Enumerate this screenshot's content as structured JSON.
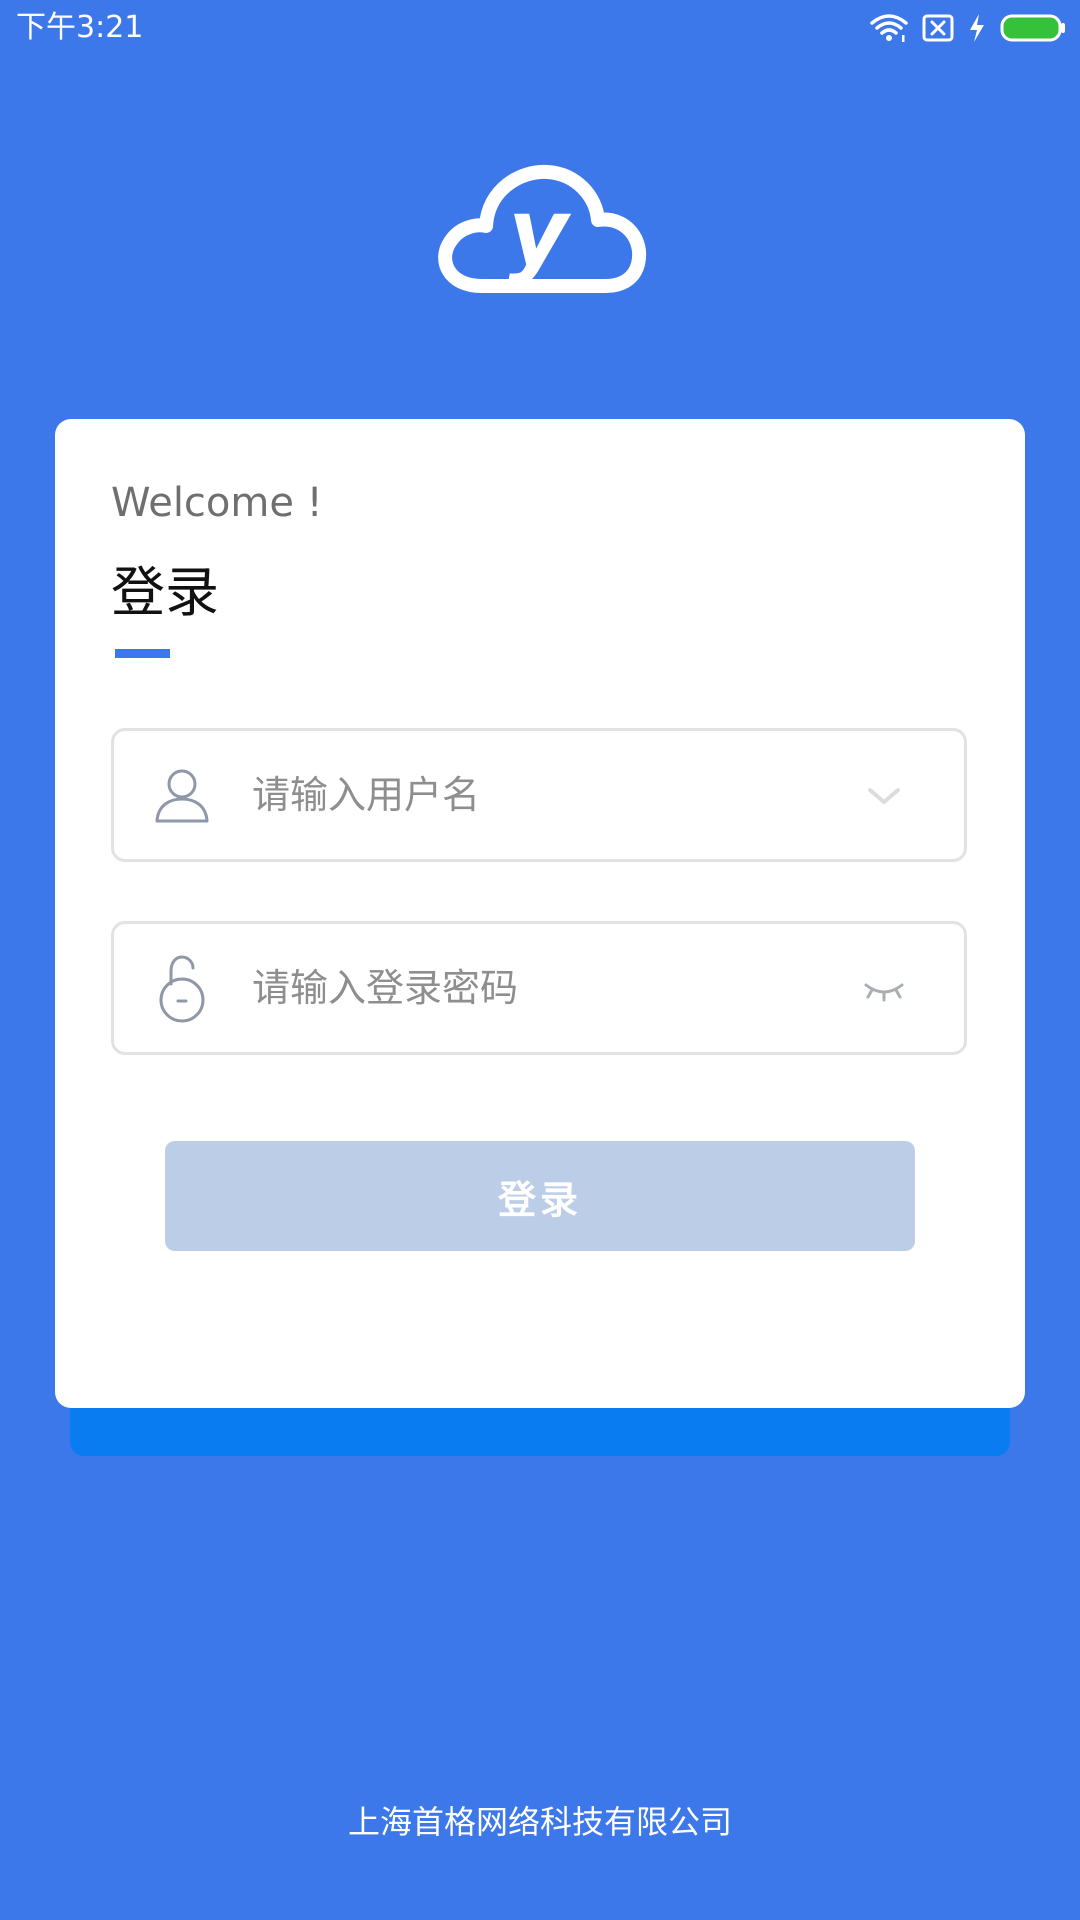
{
  "status_bar": {
    "time": "下午3:21",
    "icons": [
      "wifi-icon",
      "sim-off-icon",
      "charging-icon",
      "battery-icon"
    ],
    "battery_color": "#35c13a"
  },
  "logo": {
    "letter": "y",
    "icon": "cloud-logo-icon"
  },
  "login_card": {
    "welcome": "Welcome !",
    "title": "登录",
    "username_placeholder": "请输入用户名",
    "password_placeholder": "请输入登录密码",
    "login_button": "登录"
  },
  "footer": {
    "company": "上海首格网络科技有限公司"
  },
  "colors": {
    "background": "#3d78ea",
    "accent": "#3d78ea",
    "button_disabled": "#bccde7",
    "card_shadow": "#0a7cf1"
  }
}
